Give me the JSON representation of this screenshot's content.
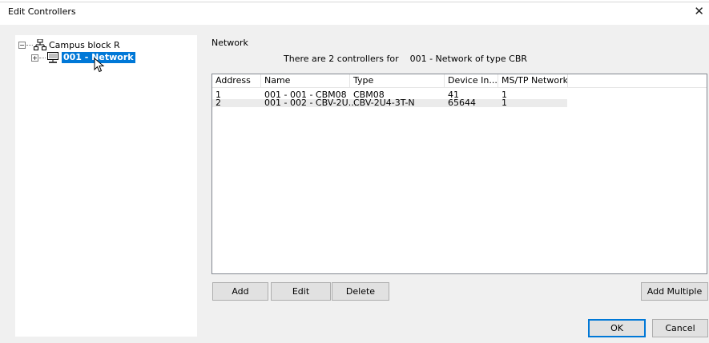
{
  "window": {
    "title": "Edit Controllers",
    "close_glyph": "✕"
  },
  "tree": {
    "root": {
      "label": "Campus block R",
      "expander": "−",
      "icon": "network-tree-icon"
    },
    "child": {
      "label": "001 - Network",
      "expander": "+",
      "icon": "monitor-icon",
      "selected": true
    }
  },
  "details": {
    "section_label": "Network",
    "info": "There are 2 controllers for    001 - Network of type CBR"
  },
  "table": {
    "columns": [
      "Address",
      "Name",
      "Type",
      "Device In...",
      "MS/TP Network"
    ],
    "rows": [
      {
        "address": "1",
        "name": "001 - 001 - CBM08",
        "type": "CBM08",
        "device": "41",
        "mstp": "1"
      },
      {
        "address": "2",
        "name": "001 - 002 - CBV-2U...",
        "type": "CBV-2U4-3T-N",
        "device": "65644",
        "mstp": "1"
      }
    ]
  },
  "buttons": {
    "add": "Add",
    "edit": "Edit",
    "delete": "Delete",
    "add_multiple": "Add Multiple",
    "ok": "OK",
    "cancel": "Cancel"
  },
  "colors": {
    "selection": "#0078d7",
    "dialog_bg": "#f0f0f0"
  }
}
